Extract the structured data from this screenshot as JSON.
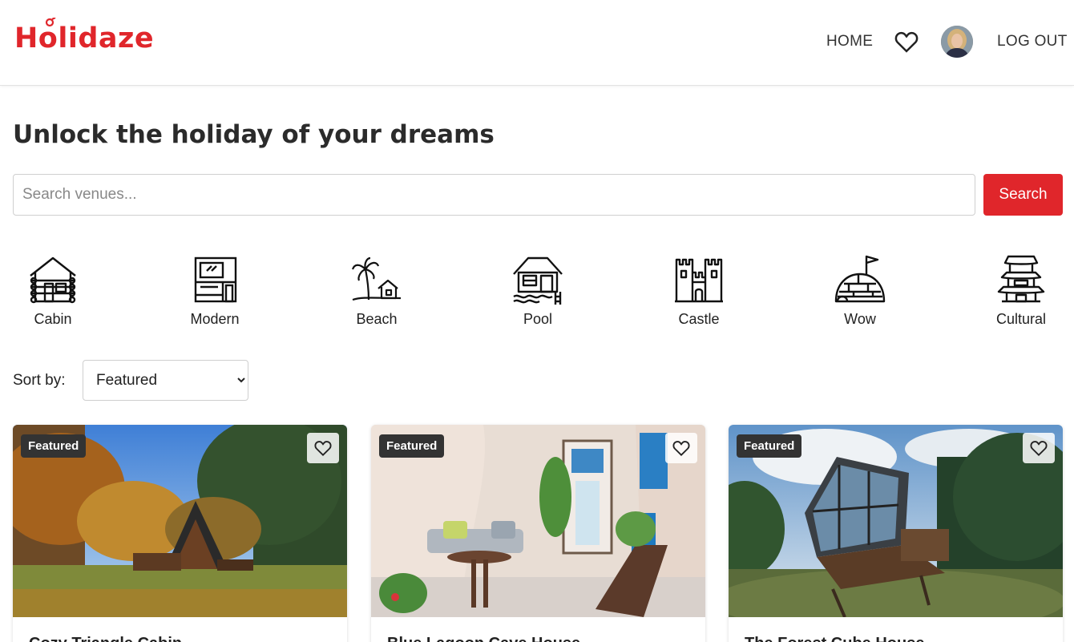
{
  "header": {
    "logo_text": "Holidaze",
    "nav": {
      "home": "HOME",
      "logout": "LOG OUT"
    },
    "icons": {
      "favorites": "heart-icon",
      "avatar": "user-avatar"
    }
  },
  "hero": {
    "title": "Unlock the holiday of your dreams"
  },
  "search": {
    "placeholder": "Search venues...",
    "value": "",
    "button_label": "Search"
  },
  "categories": [
    {
      "label": "Cabin",
      "icon": "cabin-icon"
    },
    {
      "label": "Modern",
      "icon": "modern-house-icon"
    },
    {
      "label": "Beach",
      "icon": "beach-icon"
    },
    {
      "label": "Pool",
      "icon": "pool-icon"
    },
    {
      "label": "Castle",
      "icon": "castle-icon"
    },
    {
      "label": "Wow",
      "icon": "igloo-icon"
    },
    {
      "label": "Cultural",
      "icon": "pagoda-icon"
    }
  ],
  "sort": {
    "label": "Sort by:",
    "selected": "Featured",
    "options": [
      "Featured"
    ]
  },
  "cards": [
    {
      "badge": "Featured",
      "title": "Cozy Triangle Cabin"
    },
    {
      "badge": "Featured",
      "title": "Blue Lagoon Cave House"
    },
    {
      "badge": "Featured",
      "title": "The Forest Cube House"
    }
  ],
  "colors": {
    "accent": "#e0262b",
    "badge_bg": "#333333",
    "text": "#222222"
  }
}
